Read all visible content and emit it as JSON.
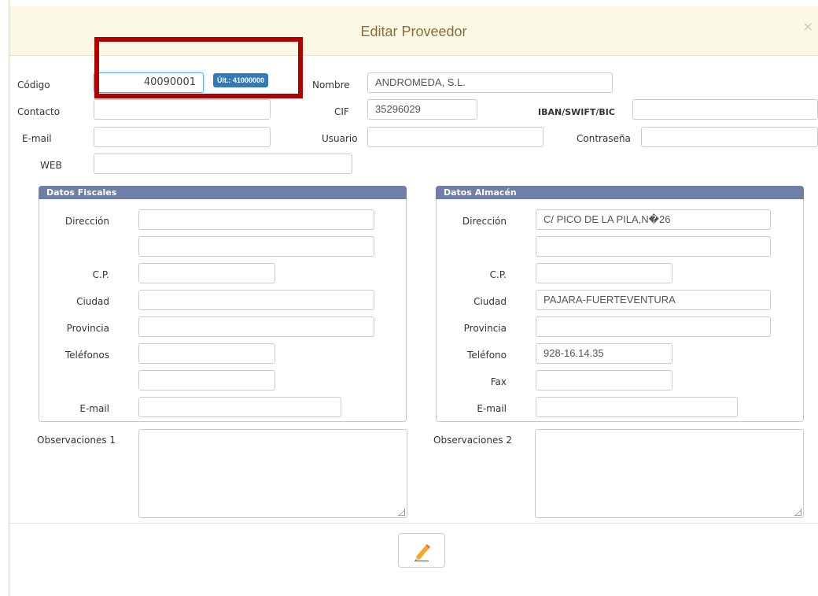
{
  "dialog": {
    "title": "Editar Proveedor",
    "close_label": "×"
  },
  "general": {
    "codigo": {
      "label": "Código",
      "value": "40090001",
      "badge": "Últ.: 41000000"
    },
    "nombre": {
      "label": "Nombre",
      "value": "ANDROMEDA, S.L."
    },
    "contacto": {
      "label": "Contacto",
      "value": ""
    },
    "cif": {
      "label": "CIF",
      "value": "35296029"
    },
    "iban": {
      "label": "IBAN/SWIFT/BIC",
      "value": ""
    },
    "email": {
      "label": "E-mail",
      "value": ""
    },
    "usuario": {
      "label": "Usuario",
      "value": ""
    },
    "contrasena": {
      "label": "Contraseña",
      "value": ""
    },
    "web": {
      "label": "WEB",
      "value": ""
    }
  },
  "fiscales": {
    "title": "Datos Fiscales",
    "direccion_label": "Dirección",
    "direccion1": "",
    "direccion2": "",
    "cp_label": "C.P.",
    "cp": "",
    "ciudad_label": "Ciudad",
    "ciudad": "",
    "provincia_label": "Provincia",
    "provincia": "",
    "telefonos_label": "Teléfonos",
    "telefono1": "",
    "telefono2": "",
    "email_label": "E-mail",
    "email": ""
  },
  "almacen": {
    "title": "Datos Almacén",
    "direccion_label": "Dirección",
    "direccion1": "C/ PICO DE LA PILA,N�26",
    "direccion2": "",
    "cp_label": "C.P.",
    "cp": "",
    "ciudad_label": "Ciudad",
    "ciudad": "PAJARA-FUERTEVENTURA",
    "provincia_label": "Provincia",
    "provincia": "",
    "telefono_label": "Teléfono",
    "telefono": "928-16.14.35",
    "fax_label": "Fax",
    "fax": "",
    "email_label": "E-mail",
    "email": ""
  },
  "observaciones": {
    "obs1_label": "Observaciones 1",
    "obs2_label": "Observaciones 2"
  },
  "footer": {
    "edit_icon": "pencil-icon"
  },
  "colors": {
    "header_bg": "#fcf8e6",
    "title": "#8a6d3b",
    "panel_head": "#6f7fa8",
    "badge": "#337ab7",
    "highlight": "#b00000"
  }
}
